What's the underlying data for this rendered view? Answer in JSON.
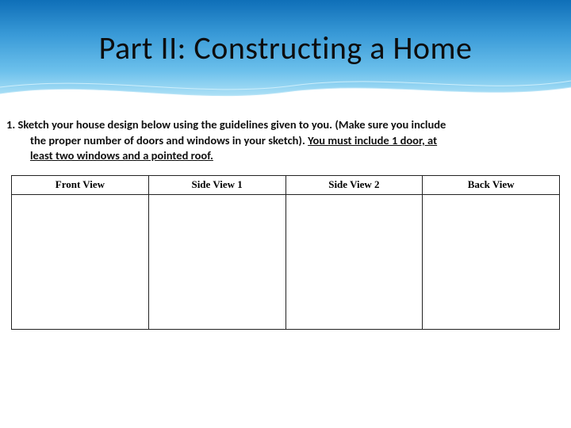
{
  "banner": {
    "title": "Part II: Constructing a Home"
  },
  "instruction": {
    "number": "1.",
    "line1_a": "Sketch your house design below using the guidelines given to you.  (Make sure you include",
    "line2": "the proper number of doors and windows in your sketch).  ",
    "bold_req_a": "You must include 1 door, at",
    "bold_req_b": "least two windows and a pointed roof."
  },
  "table": {
    "headers": [
      "Front View",
      "Side View 1",
      "Side View 2",
      "Back View"
    ]
  }
}
